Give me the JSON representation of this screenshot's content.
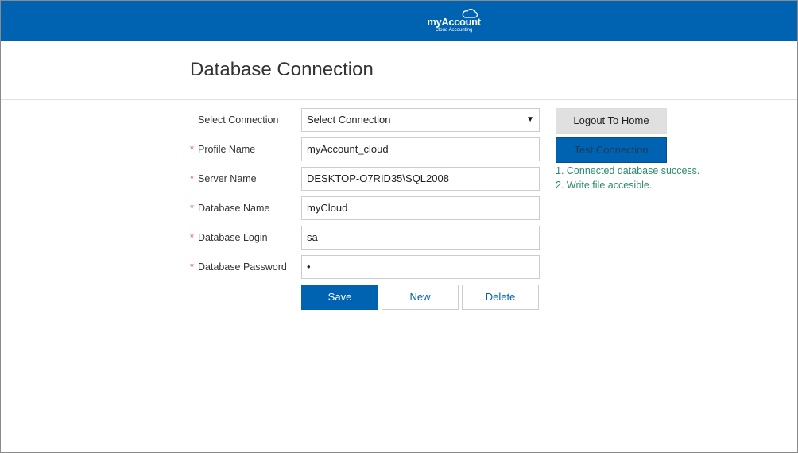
{
  "header": {
    "logo_title": "myAccount",
    "logo_subtitle": "Cloud Accounting"
  },
  "page": {
    "title": "Database Connection"
  },
  "form": {
    "select_connection": {
      "label": "Select Connection",
      "value": "Select Connection"
    },
    "profile_name": {
      "label": "Profile Name",
      "value": "myAccount_cloud"
    },
    "server_name": {
      "label": "Server Name",
      "value": "DESKTOP-O7RID35\\SQL2008"
    },
    "database_name": {
      "label": "Database Name",
      "value": "myCloud"
    },
    "database_login": {
      "label": "Database Login",
      "value": "sa"
    },
    "database_password": {
      "label": "Database Password",
      "value": "•"
    },
    "required_marker": "*"
  },
  "buttons": {
    "save": "Save",
    "new": "New",
    "delete": "Delete",
    "logout": "Logout To Home",
    "test": "Test Connection"
  },
  "status_messages": [
    "1. Connected database success.",
    "2. Write file accesible."
  ],
  "colors": {
    "brand": "#0063b1",
    "success_text": "#2e8b6e",
    "required": "#d9534f"
  },
  "icons": {
    "logo": "cloud-icon",
    "select_arrow": "triangle-down-icon"
  }
}
